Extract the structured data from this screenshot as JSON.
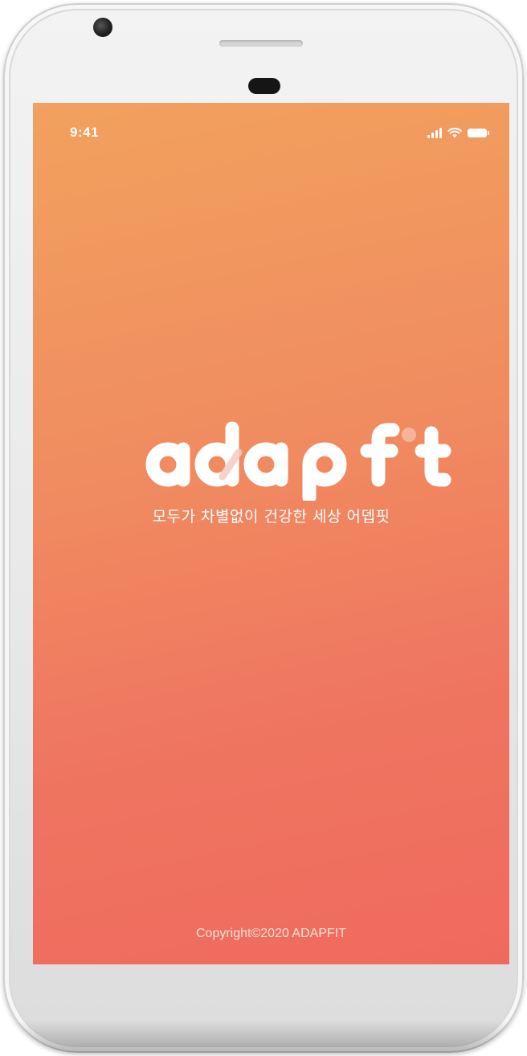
{
  "status_bar": {
    "time": "9:41",
    "icons": [
      "cellular-signal-icon",
      "wifi-icon",
      "battery-icon"
    ]
  },
  "splash": {
    "logo_text": "adapfit",
    "tagline": "모두가 차별없이 건강한 세상 어뎁핏",
    "copyright": "Copyright©2020 ADAPFIT"
  },
  "colors": {
    "gradient_top": "#f2a15e",
    "gradient_bottom": "#ef6a5e",
    "text": "#ffffff"
  }
}
